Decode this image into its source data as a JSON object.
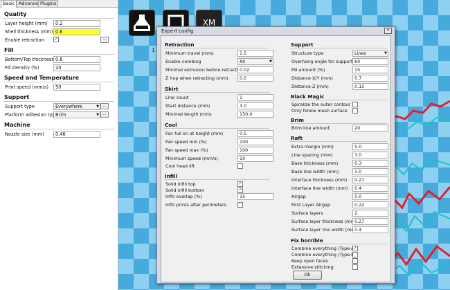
{
  "left": {
    "tabs": [
      "Basic",
      "Advanced",
      "Plugins"
    ],
    "sections": {
      "quality": "Quality",
      "fill": "Fill",
      "speed": "Speed and Temperature",
      "support": "Support",
      "machine": "Machine"
    },
    "layer_height": {
      "label": "Layer height (mm)",
      "value": "0.2"
    },
    "shell_thickness": {
      "label": "Shell thickness (mm)",
      "value": "0.6"
    },
    "enable_retraction": {
      "label": "Enable retraction",
      "checked": "✓"
    },
    "bottom_top": {
      "label": "Bottom/Top thickness (mm)",
      "value": "0.6"
    },
    "fill_density": {
      "label": "Fill Density (%)",
      "value": "20"
    },
    "print_speed": {
      "label": "Print speed (mm/s)",
      "value": "50"
    },
    "support_type": {
      "label": "Support type",
      "value": "Everywhere"
    },
    "adhesion": {
      "label": "Platform adhesion type",
      "value": "Brim"
    },
    "nozzle": {
      "label": "Nozzle size (mm)",
      "value": "0.46"
    },
    "more": "..."
  },
  "viewer": {
    "toolbar_text": "XM",
    "side_glyph": "1"
  },
  "dialog": {
    "title": "Expert config",
    "close": "✕",
    "sections": {
      "retraction": "Retraction",
      "skirt": "Skirt",
      "cool": "Cool",
      "infill": "Infill",
      "support": "Support",
      "black_magic": "Black Magic",
      "brim": "Brim",
      "raft": "Raft",
      "fix_horrible": "Fix horrible"
    },
    "retraction": [
      {
        "label": "Minimum travel (mm)",
        "value": "1.5"
      },
      {
        "label": "Enable combing",
        "value": "All"
      },
      {
        "label": "Minimal extrusion before retracting (mm)",
        "value": "0.02"
      },
      {
        "label": "Z hop when retracting (mm)",
        "value": "0.0"
      }
    ],
    "skirt": [
      {
        "label": "Line count",
        "value": "1"
      },
      {
        "label": "Start distance (mm)",
        "value": "3.0"
      },
      {
        "label": "Minimal length (mm)",
        "value": "150.0"
      }
    ],
    "cool": [
      {
        "label": "Fan full on at height (mm)",
        "value": "0.5"
      },
      {
        "label": "Fan speed min (%)",
        "value": "100"
      },
      {
        "label": "Fan speed max (%)",
        "value": "100"
      },
      {
        "label": "Minimum speed (mm/s)",
        "value": "10"
      },
      {
        "label": "Cool head lift",
        "value": ""
      }
    ],
    "infill": [
      {
        "label": "Solid infill top",
        "value": "✓"
      },
      {
        "label": "Solid infill bottom",
        "value": "✓"
      },
      {
        "label": "Infill overlap (%)",
        "value": "15"
      },
      {
        "label": "Infill prints after perimeters",
        "value": ""
      }
    ],
    "support": [
      {
        "label": "Structure type",
        "value": "Lines"
      },
      {
        "label": "Overhang angle for support (deg)",
        "value": "60"
      },
      {
        "label": "Fill amount (%)",
        "value": "15"
      },
      {
        "label": "Distance X/Y (mm)",
        "value": "0.7"
      },
      {
        "label": "Distance Z (mm)",
        "value": "0.15"
      }
    ],
    "black_magic": [
      {
        "label": "Spiralize the outer contour",
        "value": ""
      },
      {
        "label": "Only follow mesh surface",
        "value": ""
      }
    ],
    "brim": [
      {
        "label": "Brim line amount",
        "value": "20"
      }
    ],
    "raft": [
      {
        "label": "Extra margin (mm)",
        "value": "5.0"
      },
      {
        "label": "Line spacing (mm)",
        "value": "3.0"
      },
      {
        "label": "Base thickness (mm)",
        "value": "0.3"
      },
      {
        "label": "Base line width (mm)",
        "value": "1.0"
      },
      {
        "label": "Interface thickness (mm)",
        "value": "0.27"
      },
      {
        "label": "Interface line width (mm)",
        "value": "0.4"
      },
      {
        "label": "Airgap",
        "value": "0.0"
      },
      {
        "label": "First Layer Airgap",
        "value": "0.22"
      },
      {
        "label": "Surface layers",
        "value": "2"
      },
      {
        "label": "Surface layer thickness (mm)",
        "value": "0.27"
      },
      {
        "label": "Surface layer line width (mm)",
        "value": "0.4"
      }
    ],
    "fix_horrible": [
      {
        "label": "Combine everything (Type-A)",
        "value": "✓"
      },
      {
        "label": "Combine everything (Type-B)",
        "value": ""
      },
      {
        "label": "Keep open faces",
        "value": ""
      },
      {
        "label": "Extensive stitching",
        "value": ""
      }
    ],
    "ok": "Ok"
  },
  "colors": {
    "bed_dark": "#46aadc",
    "bed_light": "#8ed0f2",
    "highlight_field": "#ffff2b",
    "print_red": "#e0202a",
    "print_teal": "#19c6c6"
  }
}
